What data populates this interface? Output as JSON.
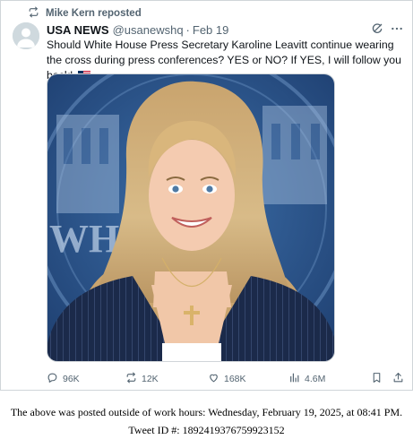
{
  "repost": {
    "label": "Mike Kern reposted"
  },
  "tweet": {
    "author_name": "USA NEWS",
    "handle": "@usanewshq",
    "separator": "·",
    "date": "Feb 19",
    "text": "Should White House Press Secretary Karoline Leavitt continue wearing the cross during press conferences? YES or NO? If YES, I will follow you back!",
    "image_caption_text": "WHI"
  },
  "stats": {
    "replies": "96K",
    "reposts": "12K",
    "likes": "168K",
    "views": "4.6M"
  },
  "icons": [
    "repost-icon",
    "avatar-placeholder",
    "grok-icon",
    "more-icon",
    "us-flag-emoji",
    "reply-icon",
    "retweet-icon",
    "heart-icon",
    "views-icon",
    "bookmark-icon",
    "share-icon"
  ],
  "colors": {
    "secondary_text": "#536471",
    "primary_text": "#0f1419",
    "border": "#d0d5d9"
  },
  "footer": {
    "line1": "The above was posted outside of work hours: Wednesday, February 19, 2025, at 08:41 PM.",
    "line2": "Tweet ID #: 1892419376759923152"
  }
}
